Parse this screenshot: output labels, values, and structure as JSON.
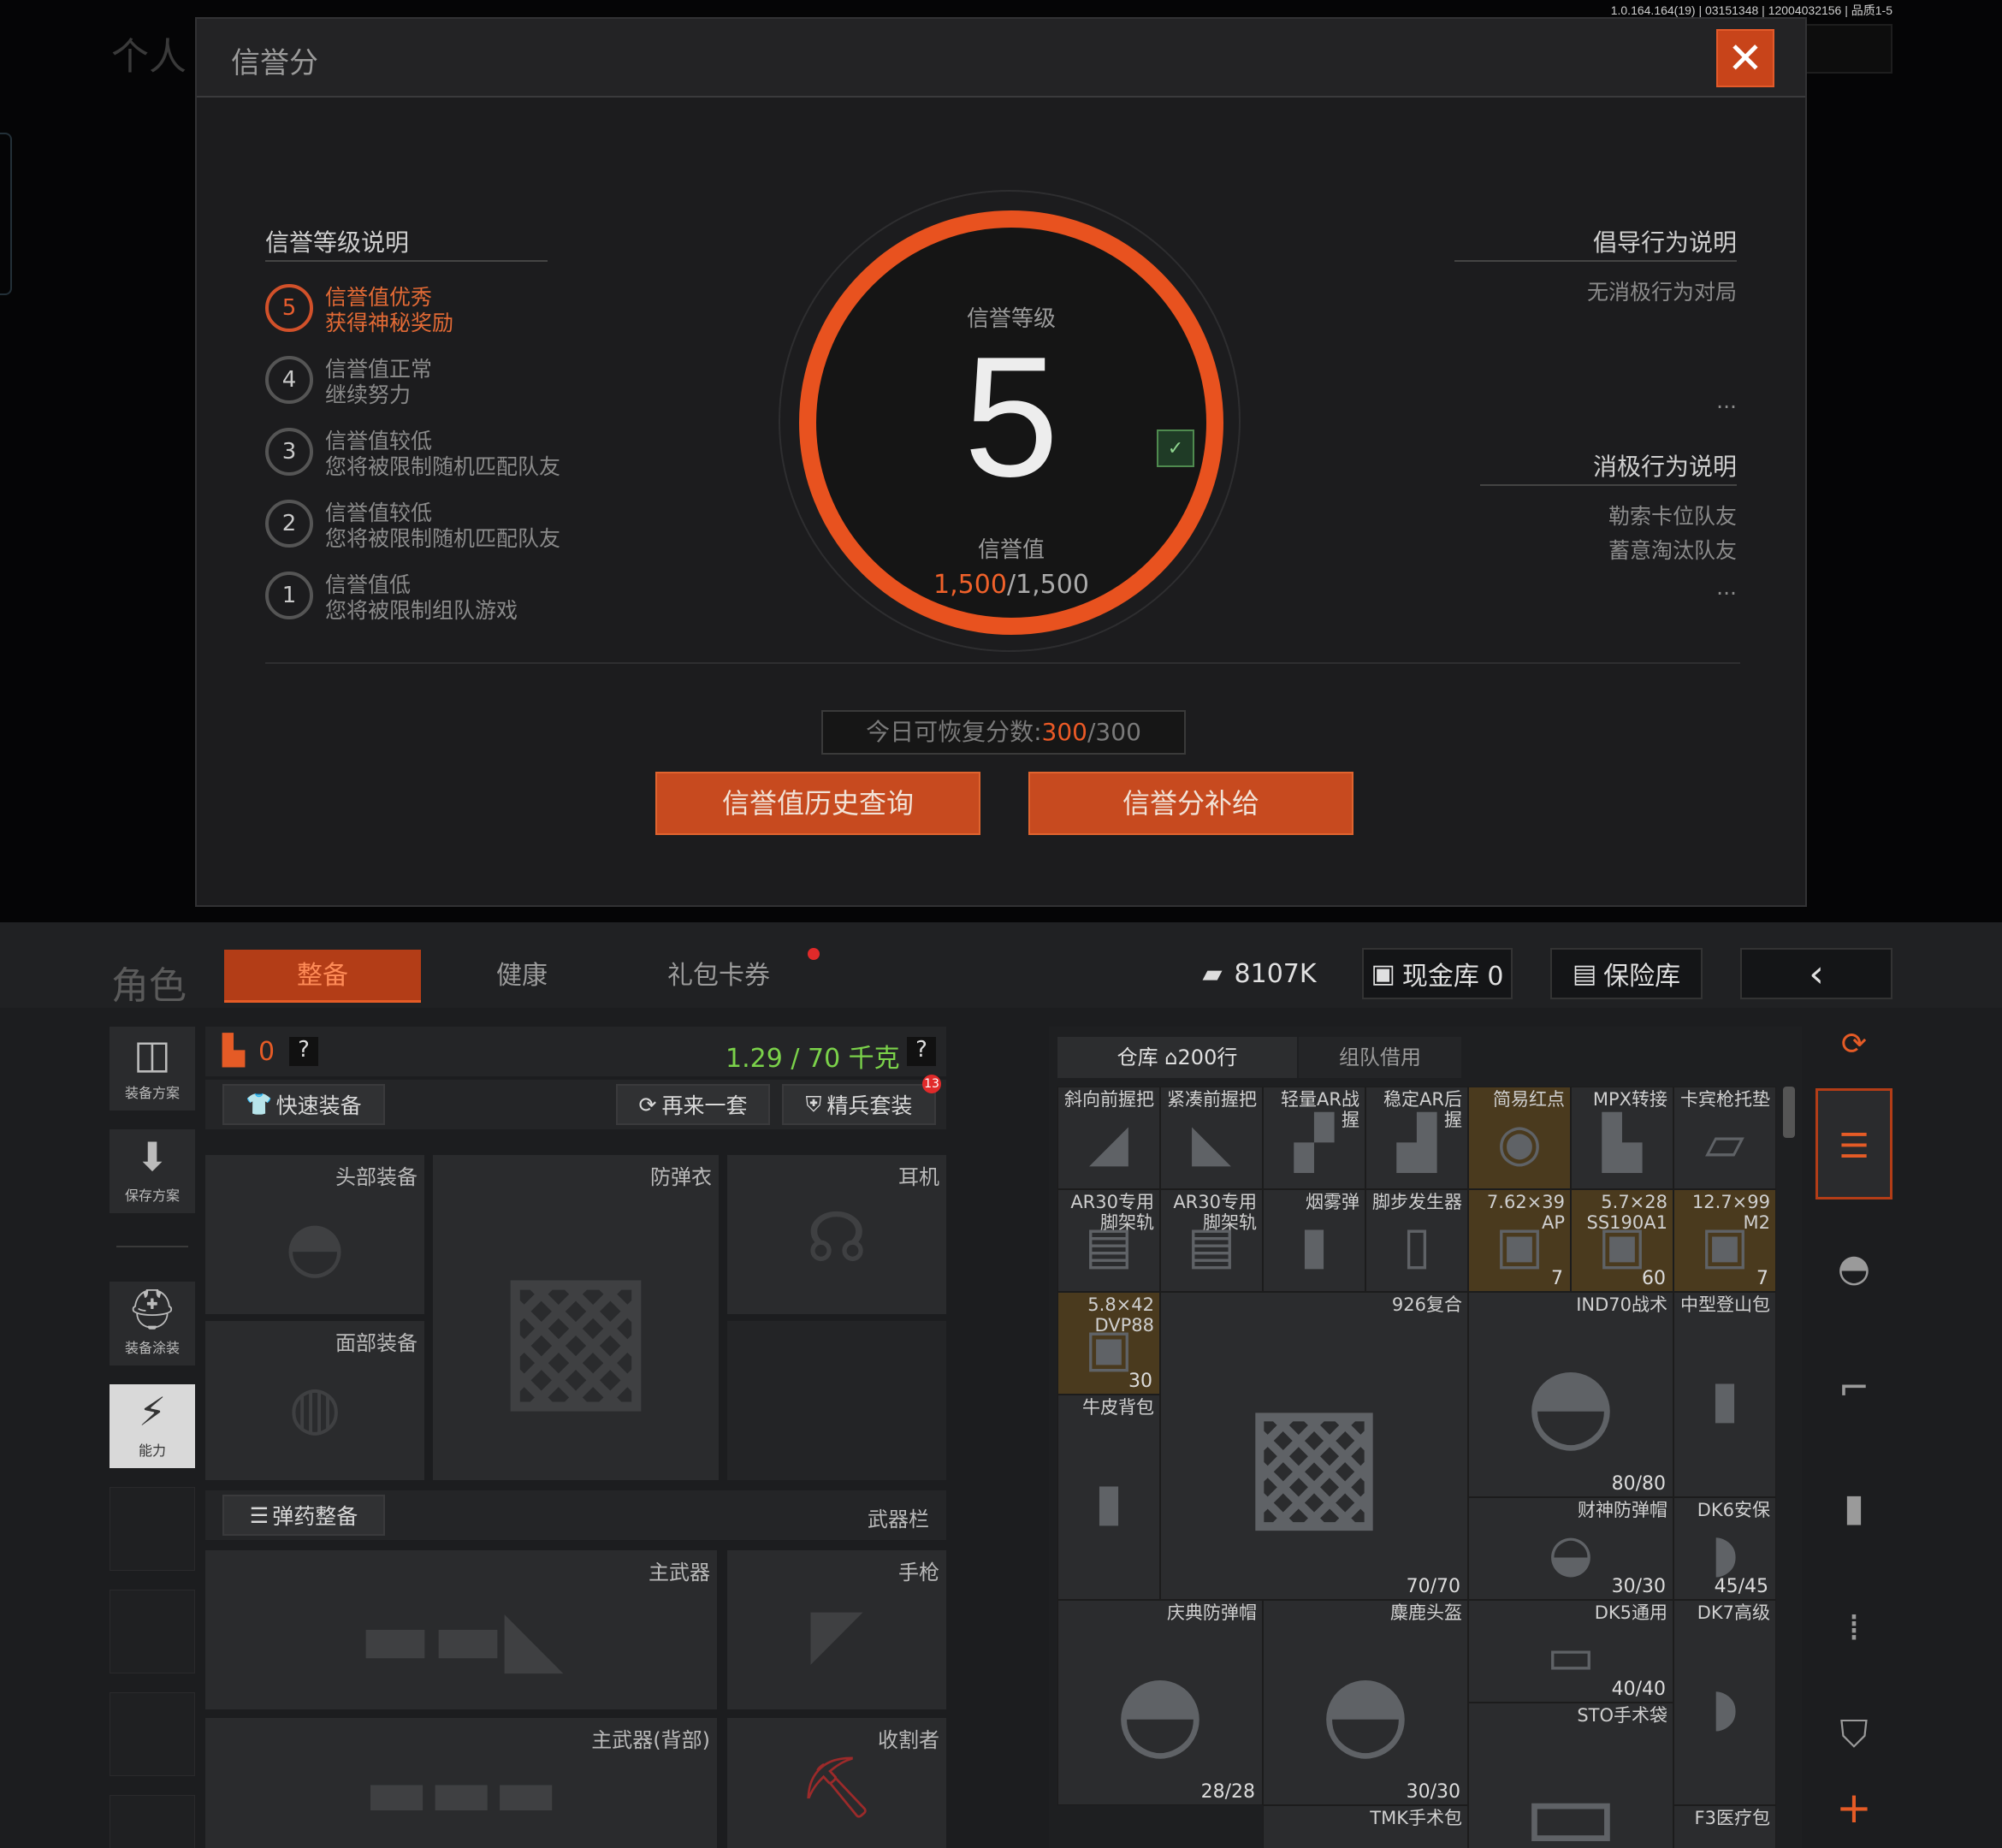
{
  "version": "1.0.164.164(19) | 03151348 | 12004032156 | 品质1-5",
  "top": {
    "bg_title": "个人",
    "title": "信誉分",
    "close_icon": "close-icon",
    "left_heading": "信誉等级说明",
    "levels": [
      {
        "num": "5",
        "line1": "信誉值优秀",
        "line2": "获得神秘奖励",
        "active": true
      },
      {
        "num": "4",
        "line1": "信誉值正常",
        "line2": "继续努力"
      },
      {
        "num": "3",
        "line1": "信誉值较低",
        "line2": "您将被限制随机匹配队友"
      },
      {
        "num": "2",
        "line1": "信誉值较低",
        "line2": "您将被限制随机匹配队友"
      },
      {
        "num": "1",
        "line1": "信誉值低",
        "line2": "您将被限制组队游戏"
      }
    ],
    "gauge": {
      "label": "信誉等级",
      "level": "5",
      "value_label": "信誉值",
      "value_current": "1,500",
      "value_max": "/1,500"
    },
    "positive_heading": "倡导行为说明",
    "positive_items": [
      "无消极行为对局"
    ],
    "negative_heading": "消极行为说明",
    "negative_items": [
      "勒索卡位队友",
      "蓄意淘汰队友"
    ],
    "ellipsis": "...",
    "recover_label": "今日可恢复分数:",
    "recover_current": "300",
    "recover_max": "/300",
    "history_button": "信誉值历史查询",
    "supply_button": "信誉分补给",
    "accent": "#e8521f"
  },
  "bottom": {
    "title": "角色",
    "tabs": [
      "整备",
      "健康",
      "礼包卡券"
    ],
    "money": "8107K",
    "cash_vault": "现金库 0",
    "safe": "保险库",
    "side": [
      {
        "label": "装备方案"
      },
      {
        "label": "保存方案"
      },
      {
        "label": "装备涂装"
      },
      {
        "label": "能力"
      }
    ],
    "armor_count": "0",
    "weight": "1.29 / 70 千克",
    "help": "?",
    "quick_equip": "快速装备",
    "again": "再来一套",
    "elite": "精兵套装",
    "elite_badge": "13",
    "slots": {
      "head": "头部装备",
      "vest": "防弹衣",
      "ear": "耳机",
      "face": "面部装备",
      "primary": "主武器",
      "pistol": "手枪",
      "primary2": "主武器(背部)",
      "melee": "收割者"
    },
    "ammo_equip": "弹药整备",
    "weapon_bar": "武器栏",
    "warehouse_tab": "仓库",
    "warehouse_rows": "200行",
    "team_tab": "组队借用",
    "items": [
      {
        "name": "斜向前握把",
        "count": ""
      },
      {
        "name": "紧凑前握把",
        "count": ""
      },
      {
        "name": "轻量AR战握",
        "count": ""
      },
      {
        "name": "稳定AR后握",
        "count": ""
      },
      {
        "name": "简易红点",
        "count": ""
      },
      {
        "name": "MPX转接",
        "count": ""
      },
      {
        "name": "卡宾枪托垫",
        "count": ""
      },
      {
        "name": "AR30专用脚架轨",
        "count": ""
      },
      {
        "name": "AR30专用脚架轨",
        "count": ""
      },
      {
        "name": "烟雾弹",
        "count": ""
      },
      {
        "name": "脚步发生器",
        "count": ""
      },
      {
        "name": "7.62×39 AP",
        "count": "7"
      },
      {
        "name": "5.7×28 SS190A1",
        "count": "60"
      },
      {
        "name": "12.7×99 M2",
        "count": "7"
      },
      {
        "name": "5.8×42 DVP88",
        "count": "30"
      },
      {
        "name": "926复合",
        "count": "70/70"
      },
      {
        "name": "IND70战术",
        "count": "80/80"
      },
      {
        "name": "中型登山包",
        "count": ""
      },
      {
        "name": "牛皮背包",
        "count": ""
      },
      {
        "name": "财神防弹帽",
        "count": "30/30"
      },
      {
        "name": "DK6安保",
        "count": "45/45"
      },
      {
        "name": "庆典防弹帽",
        "count": "28/28"
      },
      {
        "name": "麋鹿头盔",
        "count": "30/30"
      },
      {
        "name": "DK5通用",
        "count": "40/40"
      },
      {
        "name": "DK7高级",
        "count": ""
      },
      {
        "name": "TMK手术包",
        "count": ""
      },
      {
        "name": "STO手术袋",
        "count": ""
      },
      {
        "name": "F3医疗包",
        "count": ""
      }
    ],
    "accent": "#b33d17",
    "weight_color": "#7bd24a"
  }
}
